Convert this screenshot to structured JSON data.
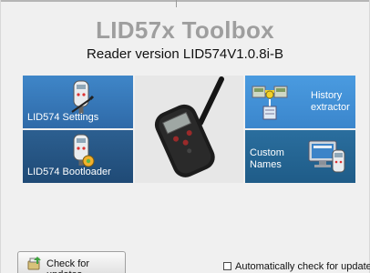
{
  "app": {
    "title": "LID57x Toolbox",
    "reader_version": "Reader version LID574V1.0.8i-B"
  },
  "tiles": {
    "settings": {
      "label": "LID574 Settings",
      "icon": "reader-settings-icon"
    },
    "bootloader": {
      "label": "LID574 Bootloader",
      "icon": "reader-bootloader-icon"
    },
    "device_photo": {
      "icon": "handheld-reader-device-image"
    },
    "history": {
      "label_line1": "History",
      "label_line2": "extractor",
      "icon": "history-extractor-icon"
    },
    "names": {
      "label_line1": "Custom",
      "label_line2": "Names",
      "icon": "custom-names-icon"
    }
  },
  "footer": {
    "check_updates_label": "Check for updates",
    "auto_check_label": "Automatically check for updates",
    "auto_check_checked": false
  }
}
